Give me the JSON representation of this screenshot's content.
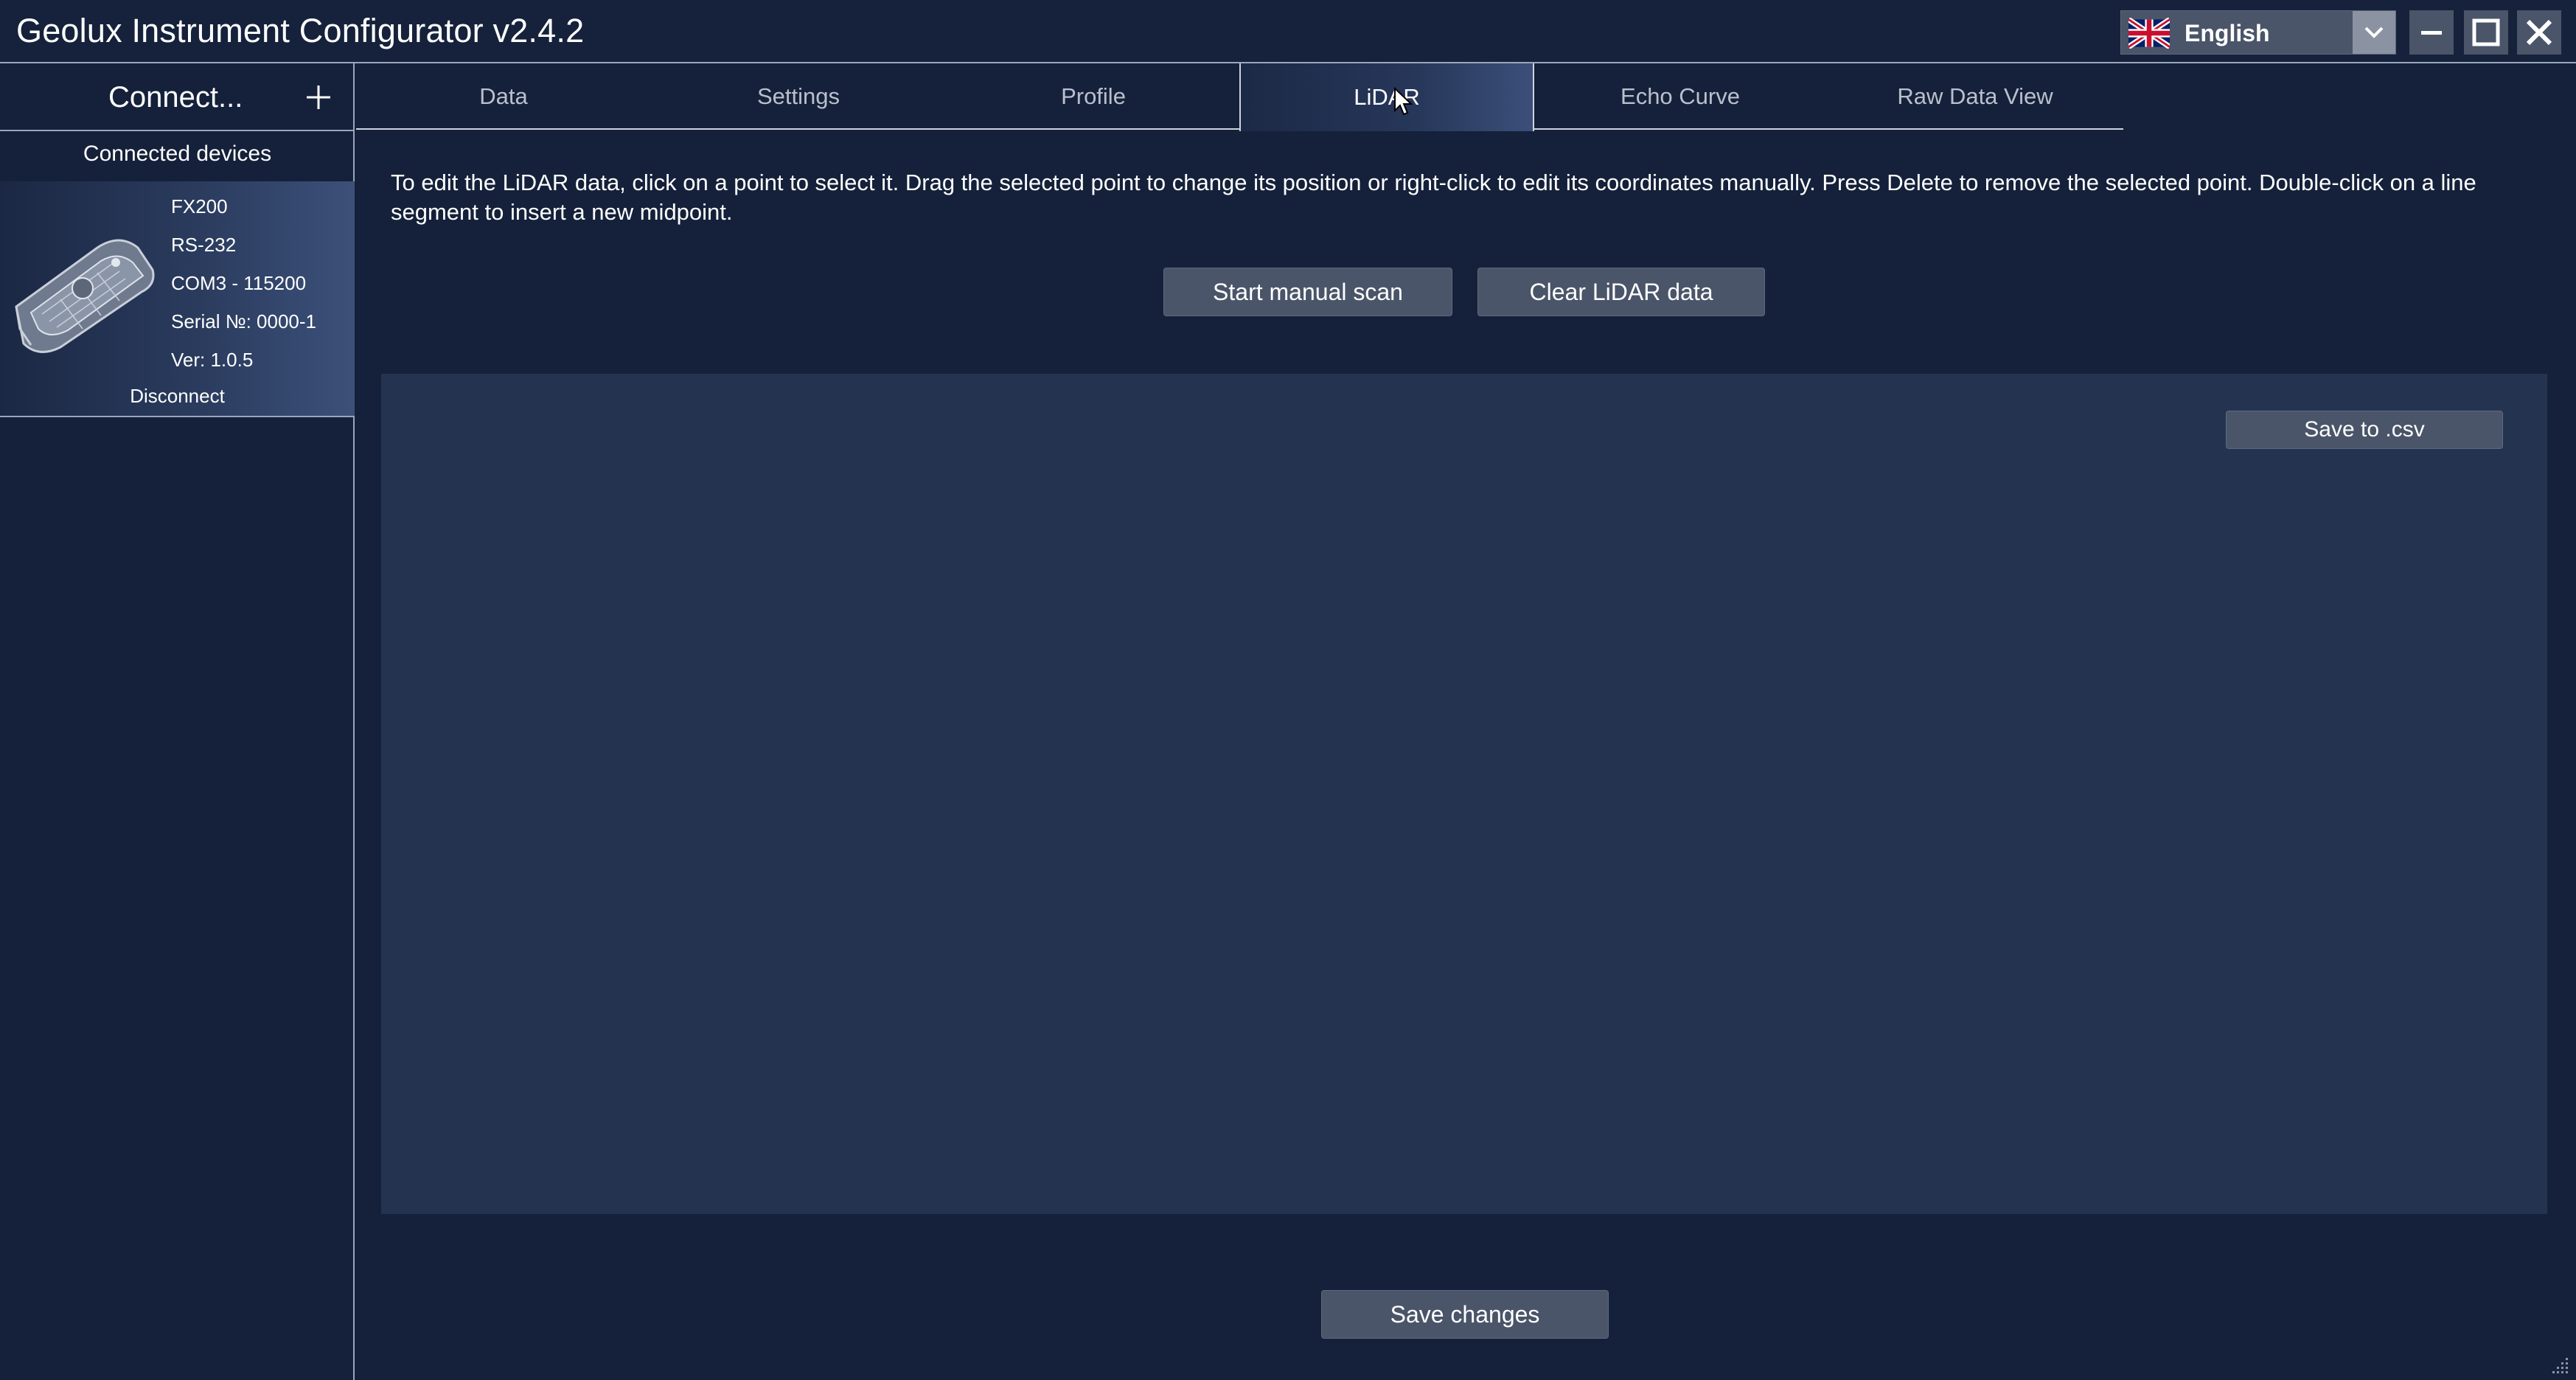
{
  "window": {
    "title": "Geolux Instrument Configurator v2.4.2",
    "language": {
      "selected": "English",
      "flag_icon": "uk-flag-icon"
    }
  },
  "sidebar": {
    "connect_label": "Connect...",
    "add_icon": "plus-icon",
    "devices_heading": "Connected devices",
    "device": {
      "model": "FX200",
      "interface": "RS-232",
      "port": "COM3 - 115200",
      "serial": "Serial №: 0000-1",
      "version": "Ver:  1.0.5",
      "disconnect_label": "Disconnect"
    }
  },
  "tabs": [
    {
      "label": "Data"
    },
    {
      "label": "Settings"
    },
    {
      "label": "Profile"
    },
    {
      "label": "LiDAR"
    },
    {
      "label": "Echo Curve"
    },
    {
      "label": "Raw Data View"
    }
  ],
  "active_tab": "LiDAR",
  "lidar": {
    "instructions": "To edit the LiDAR data, click on a point to select it. Drag the selected point to change its position or right-click to edit its coordinates manually. Press Delete to remove the selected point. Double-click on a line segment to insert a new midpoint.",
    "start_scan_label": "Start manual scan",
    "clear_label": "Clear LiDAR data",
    "save_csv_label": "Save to .csv",
    "save_changes_label": "Save changes"
  },
  "colors": {
    "background": "#15213a",
    "panel": "#243350",
    "button": "#4a5569",
    "text": "#ffffff"
  }
}
